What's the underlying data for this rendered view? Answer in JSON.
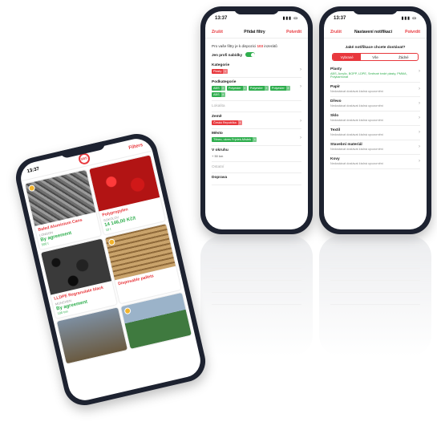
{
  "phone_listing": {
    "time": "13:37",
    "logo": "SBS",
    "filters_label": "Filters",
    "cards": [
      {
        "name": "Baled Aluminium Cans",
        "location": "LONDON",
        "price": "By agreement",
        "qty": "500 t"
      },
      {
        "name": "Polypropylen",
        "location": "SOKOLOV",
        "price": "14 146,00 Kč/t",
        "qty": "10 t"
      },
      {
        "name": "LLDPE Regranulate black",
        "location": "MÜNCHEN",
        "price": "By agreement",
        "qty": "100 ton"
      },
      {
        "name": "Disposable pallets",
        "location": "",
        "price": "",
        "qty": ""
      },
      {
        "name": "",
        "location": "",
        "price": "",
        "qty": ""
      },
      {
        "name": "",
        "location": "",
        "price": "",
        "qty": ""
      }
    ]
  },
  "phone_filters": {
    "time": "13:37",
    "nav_left": "Zrušit",
    "nav_title": "Přidat filtry",
    "nav_right": "Potvrdit",
    "hint_prefix": "Pro vaše filtry je k dispozici",
    "hint_count": "103",
    "hint_suffix": "inzerátů",
    "only_profile_label": "Jen profi nabídky",
    "category_label": "Kategorie",
    "category_tags": [
      "Plasty"
    ],
    "subcategory_label": "Podkategorie",
    "subcategory_tags": [
      "ABS",
      "Polyester",
      "Polyester",
      "Polyester",
      "ABS"
    ],
    "location_label": "Lokalita",
    "country_label": "Země",
    "country_tags": [
      "Česká Republika"
    ],
    "city_label": "Město",
    "city_tags": [
      "Třinec, okres Frýdek-Místek"
    ],
    "distance_label": "V okruhu",
    "distance_value": "+ 50 km",
    "other_label": "Ostatní",
    "transport_label": "Doprava"
  },
  "phone_notifications": {
    "time": "13:37",
    "nav_left": "Zrušit",
    "nav_title": "Nastavení notifikací",
    "nav_right": "Potvrdit",
    "question": "Jaké notifikace chcete dostávat?",
    "segments": [
      "Vybrané",
      "Vše",
      "Žádné"
    ],
    "items": [
      {
        "title": "Plasty",
        "desc": "ABS, Acrylic, BOPP, LDPE, Směsné tvrdé plasty, PMMA, Polykarbonát",
        "green": true
      },
      {
        "title": "Papír",
        "desc": "Nedostávat dostávat žádná upozornění",
        "green": false
      },
      {
        "title": "Dřevo",
        "desc": "Nedostávat dostávat žádná upozornění",
        "green": false
      },
      {
        "title": "Sklo",
        "desc": "Nedostávat dostávat žádná upozornění",
        "green": false
      },
      {
        "title": "Textil",
        "desc": "Nedostávat dostávat žádná upozornění",
        "green": false
      },
      {
        "title": "Stavební materiál",
        "desc": "Nedostávat dostávat žádná upozornění",
        "green": false
      },
      {
        "title": "Kovy",
        "desc": "Nedostávat dostávat žádná upozornění",
        "green": false
      }
    ]
  },
  "colors": {
    "accent": "#e8383d",
    "green": "#2fae4e",
    "phone_frame": "#1d2230"
  }
}
